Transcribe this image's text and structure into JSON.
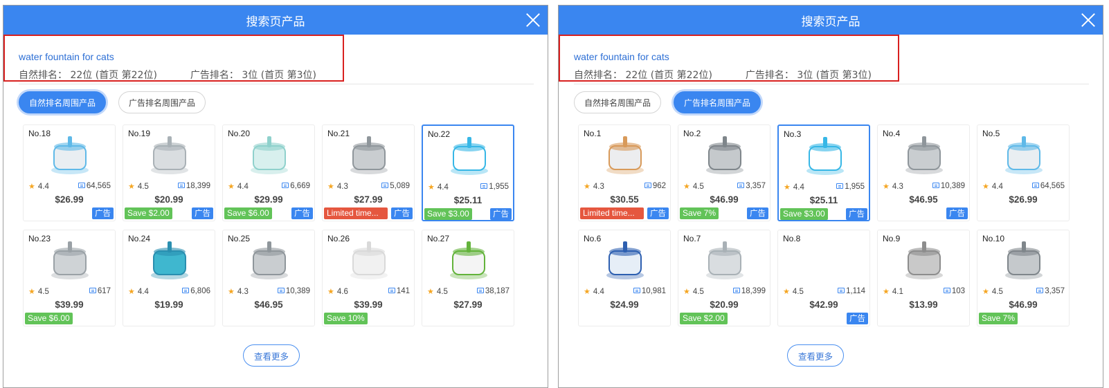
{
  "colors": {
    "accent": "#3a86f0",
    "highlight_box": "#d8201f",
    "save_badge": "#62c358",
    "deal_badge": "#e5573f",
    "star": "#f5a623"
  },
  "panels": [
    {
      "title": "搜索页产品",
      "keyword": "water fountain for cats",
      "organic_rank_label": "自然排名：",
      "organic_rank_value": "22位 (首页 第22位)",
      "ad_rank_label": "广告排名：",
      "ad_rank_value": "3位 (首页 第3位)",
      "tabs": [
        {
          "label": "自然排名周围产品",
          "active": true
        },
        {
          "label": "广告排名周围产品",
          "active": false
        }
      ],
      "more_label": "查看更多",
      "products": [
        {
          "no": "No.18",
          "rating": "4.4",
          "reviews": "64,565",
          "price": "$26.99",
          "promo": "",
          "promo_type": "",
          "ad": "广告",
          "selected": false,
          "icon": "square-fountain-icon"
        },
        {
          "no": "No.19",
          "rating": "4.5",
          "reviews": "18,399",
          "price": "$20.99",
          "promo": "Save $2.00",
          "promo_type": "green",
          "ad": "广告",
          "selected": false,
          "icon": "clear-fountain-icon"
        },
        {
          "no": "No.20",
          "rating": "4.4",
          "reviews": "6,669",
          "price": "$29.99",
          "promo": "Save $6.00",
          "promo_type": "green",
          "ad": "广告",
          "selected": false,
          "icon": "wide-fountain-icon"
        },
        {
          "no": "No.21",
          "rating": "4.3",
          "reviews": "5,089",
          "price": "$27.99",
          "promo": "Limited time...",
          "promo_type": "red",
          "ad": "广告",
          "selected": false,
          "icon": "steel-bowl-fountain-icon"
        },
        {
          "no": "No.22",
          "rating": "4.4",
          "reviews": "1,955",
          "price": "$25.11",
          "promo": "Save $3.00",
          "promo_type": "green",
          "ad": "广告",
          "selected": true,
          "icon": "blue-flower-fountain-icon"
        },
        {
          "no": "No.23",
          "rating": "4.5",
          "reviews": "617",
          "price": "$39.99",
          "promo": "Save $6.00",
          "promo_type": "green",
          "ad": "",
          "selected": false,
          "icon": "oval-steel-fountain-icon"
        },
        {
          "no": "No.24",
          "rating": "4.4",
          "reviews": "6,806",
          "price": "$19.99",
          "promo": "",
          "promo_type": "",
          "ad": "",
          "selected": false,
          "icon": "teal-fountain-icon"
        },
        {
          "no": "No.25",
          "rating": "4.3",
          "reviews": "10,389",
          "price": "$46.95",
          "promo": "",
          "promo_type": "",
          "ad": "",
          "selected": false,
          "icon": "steel-bowl-fountain-icon"
        },
        {
          "no": "No.26",
          "rating": "4.6",
          "reviews": "141",
          "price": "$39.99",
          "promo": "Save 10%",
          "promo_type": "green",
          "ad": "",
          "selected": false,
          "icon": "round-white-fountain-icon"
        },
        {
          "no": "No.27",
          "rating": "4.5",
          "reviews": "38,187",
          "price": "$27.99",
          "promo": "",
          "promo_type": "",
          "ad": "",
          "selected": false,
          "icon": "green-flower-fountain-icon"
        }
      ]
    },
    {
      "title": "搜索页产品",
      "keyword": "water fountain for cats",
      "organic_rank_label": "自然排名：",
      "organic_rank_value": "22位 (首页 第22位)",
      "ad_rank_label": "广告排名：",
      "ad_rank_value": "3位 (首页 第3位)",
      "tabs": [
        {
          "label": "自然排名周围产品",
          "active": false
        },
        {
          "label": "广告排名周围产品",
          "active": true
        }
      ],
      "more_label": "查看更多",
      "products": [
        {
          "no": "No.1",
          "rating": "4.3",
          "reviews": "962",
          "price": "$30.55",
          "promo": "Limited time...",
          "promo_type": "red",
          "ad": "广告",
          "selected": false,
          "icon": "kitten-fountain-icon"
        },
        {
          "no": "No.2",
          "rating": "4.5",
          "reviews": "3,357",
          "price": "$46.99",
          "promo": "Save 7%",
          "promo_type": "green",
          "ad": "广告",
          "selected": false,
          "icon": "steel-fountain-icon"
        },
        {
          "no": "No.3",
          "rating": "4.4",
          "reviews": "1,955",
          "price": "$25.11",
          "promo": "Save $3.00",
          "promo_type": "green",
          "ad": "广告",
          "selected": true,
          "icon": "blue-flower-fountain-icon"
        },
        {
          "no": "No.4",
          "rating": "4.3",
          "reviews": "10,389",
          "price": "$46.95",
          "promo": "",
          "promo_type": "",
          "ad": "广告",
          "selected": false,
          "icon": "steel-bowl-fountain-icon"
        },
        {
          "no": "No.5",
          "rating": "4.4",
          "reviews": "64,565",
          "price": "$26.99",
          "promo": "",
          "promo_type": "",
          "ad": "",
          "selected": false,
          "icon": "square-fountain-icon"
        },
        {
          "no": "No.6",
          "rating": "4.4",
          "reviews": "10,981",
          "price": "$24.99",
          "promo": "",
          "promo_type": "",
          "ad": "",
          "selected": false,
          "icon": "blue-fountain-icon"
        },
        {
          "no": "No.7",
          "rating": "4.5",
          "reviews": "18,399",
          "price": "$20.99",
          "promo": "Save $2.00",
          "promo_type": "green",
          "ad": "",
          "selected": false,
          "icon": "clear-fountain-icon"
        },
        {
          "no": "No.8",
          "rating": "4.5",
          "reviews": "1,114",
          "price": "$42.99",
          "promo": "",
          "promo_type": "",
          "ad": "广告",
          "selected": false,
          "icon": ""
        },
        {
          "no": "No.9",
          "rating": "4.1",
          "reviews": "103",
          "price": "$13.99",
          "promo": "",
          "promo_type": "",
          "ad": "",
          "selected": false,
          "icon": "dome-fountain-icon"
        },
        {
          "no": "No.10",
          "rating": "4.5",
          "reviews": "3,357",
          "price": "$46.99",
          "promo": "Save 7%",
          "promo_type": "green",
          "ad": "",
          "selected": false,
          "icon": "steel-fountain-icon"
        }
      ]
    }
  ]
}
